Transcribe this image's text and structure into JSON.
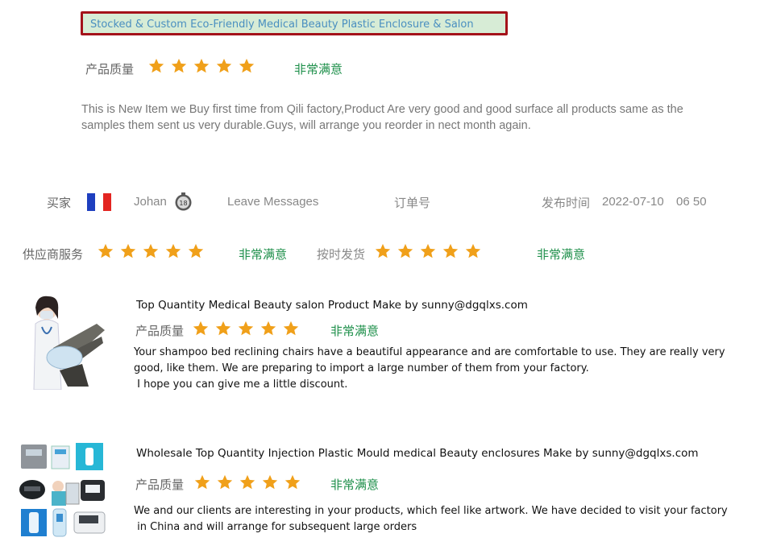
{
  "review_top": {
    "product_title": "Stocked & Custom Eco-Friendly Medical Beauty Plastic Enclosure & Salon",
    "quality_label": "产品质量",
    "quality_rating": 5,
    "quality_verdict": "非常满意",
    "text_line1": "This is New Item we Buy first time from Qili factory,Product Are very good and good surface all products same as the",
    "text_line2": "samples them sent us very durable.Guys, will arrange you reorder in nect month again."
  },
  "buyer_bar": {
    "buyer_label": "买家",
    "buyer_name": "Johan",
    "leave_messages": "Leave  Messages",
    "order_no_label": "订单号",
    "published_label": "发布时间",
    "published_date": "2022-07-10",
    "published_time": "06 50"
  },
  "service_ratings": {
    "supplier_label": "供应商服务",
    "supplier_rating": 5,
    "supplier_verdict": "非常满意",
    "ontime_label": "按时发货",
    "ontime_rating": 5,
    "ontime_verdict": "非常满意"
  },
  "items": [
    {
      "title": "Top Quantity Medical Beauty salon Product Make by sunny@dgqlxs.com",
      "quality_label": "产品质量",
      "rating": 5,
      "verdict": "非常满意",
      "text_line1": "Your shampoo bed reclining chairs have a beautiful appearance and are comfortable to use. They are really very",
      "text_line2": "good,  like them. We are preparing to import a large number of them from your factory.",
      "text_line3": " I hope you can give me a little discount."
    },
    {
      "title": "Wholesale Top Quantity Injection Plastic Mould medical Beauty enclosures Make by sunny@dgqlxs.com",
      "quality_label": "产品质量",
      "rating": 5,
      "verdict": "非常满意",
      "text_line1": "We and our clients are interesting in your products, which feel like artwork. We have decided to visit your factory",
      "text_line2": " in China and will arrange for subsequent large orders"
    }
  ],
  "colors": {
    "star": "#f0a01a",
    "verdict_green": "#1d8f4a",
    "title_box_border": "#a4121a",
    "title_box_bg": "#d7ecd6"
  },
  "icons": {
    "star": "star-icon",
    "flag": "france-flag-icon",
    "avatar": "avatar-icon"
  }
}
